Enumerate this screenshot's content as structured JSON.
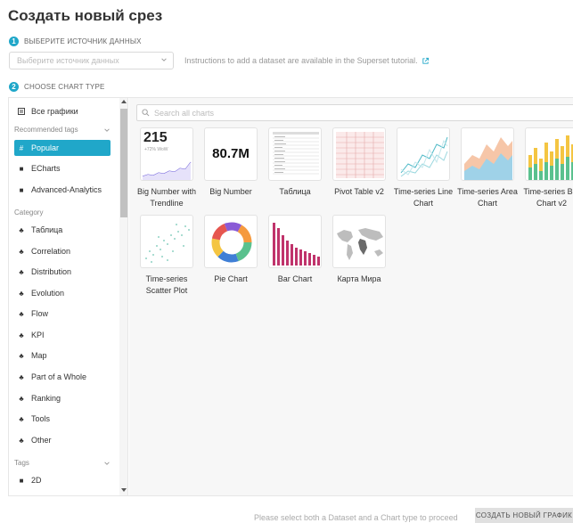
{
  "page": {
    "title": "Создать новый срез"
  },
  "step1": {
    "number": "1",
    "label": "ВЫБЕРИТЕ ИСТОЧНИК ДАННЫХ",
    "placeholder": "Выберите источник данных",
    "hint": "Instructions to add a dataset are available in the Superset tutorial."
  },
  "step2": {
    "number": "2",
    "label": "CHOOSE CHART TYPE"
  },
  "sidebar": {
    "all_charts": "Все графики",
    "recommended_label": "Recommended tags",
    "recommended": [
      "Popular",
      "ECharts",
      "Advanced-Analytics"
    ],
    "category_label": "Category",
    "categories": [
      "Таблица",
      "Correlation",
      "Distribution",
      "Evolution",
      "Flow",
      "KPI",
      "Map",
      "Part of a Whole",
      "Ranking",
      "Tools",
      "Other"
    ],
    "tags_label": "Tags",
    "tags": [
      "2D"
    ]
  },
  "search": {
    "placeholder": "Search all charts"
  },
  "charts": [
    {
      "label": "Big Number with Trendline",
      "thumb_value": "215",
      "thumb_sub": "+72% WoW"
    },
    {
      "label": "Big Number",
      "thumb_value": "80.7M"
    },
    {
      "label": "Таблица"
    },
    {
      "label": "Pivot Table v2"
    },
    {
      "label": "Time-series Line Chart"
    },
    {
      "label": "Time-series Area Chart"
    },
    {
      "label": "Time-series Bar Chart v2"
    },
    {
      "label": "Time-series Scatter Plot"
    },
    {
      "label": "Pie Chart"
    },
    {
      "label": "Bar Chart"
    },
    {
      "label": "Карта Мира"
    }
  ],
  "footer": {
    "message": "Please select both a Dataset and a Chart type to proceed",
    "create_label": "СОЗДАТЬ НОВЫЙ ГРАФИК"
  },
  "colors": {
    "accent": "#20a7c9"
  }
}
